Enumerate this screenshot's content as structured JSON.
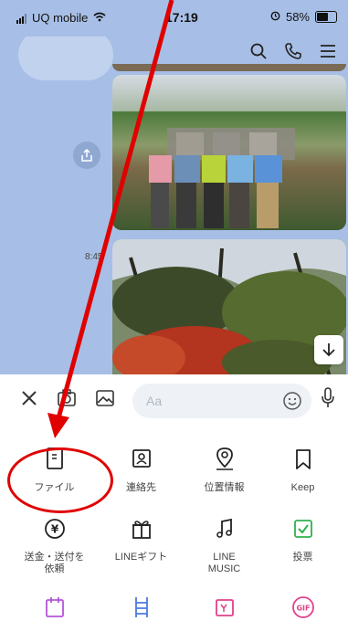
{
  "status_bar": {
    "carrier": "UQ mobile",
    "time": "17:19",
    "battery": "58%"
  },
  "chat": {
    "timestamp": "8:45"
  },
  "input": {
    "placeholder": "Aa"
  },
  "menu": {
    "row1": [
      {
        "label": "ファイル",
        "icon": "file-icon"
      },
      {
        "label": "連絡先",
        "icon": "contact-icon"
      },
      {
        "label": "位置情報",
        "icon": "location-icon"
      },
      {
        "label": "Keep",
        "icon": "bookmark-icon"
      }
    ],
    "row2": [
      {
        "label": "送金・送付を",
        "label2": "依頼",
        "icon": "yen-icon"
      },
      {
        "label": "LINEギフト",
        "icon": "gift-icon"
      },
      {
        "label": "LINE",
        "label2": "MUSIC",
        "icon": "music-icon"
      },
      {
        "label": "投票",
        "icon": "vote-icon"
      }
    ],
    "row3": [
      {
        "icon": "calendar-icon"
      },
      {
        "icon": "ladder-icon"
      },
      {
        "icon": "yahoo-icon"
      },
      {
        "icon": "gif-icon",
        "text": "GIF"
      }
    ]
  },
  "colors": {
    "chat_bg": "#a7bfe6",
    "vote_green": "#2fb04f",
    "purple": "#b255d8",
    "blue": "#4a7be0",
    "pink": "#e0408a",
    "annotation_red": "#e00000"
  }
}
